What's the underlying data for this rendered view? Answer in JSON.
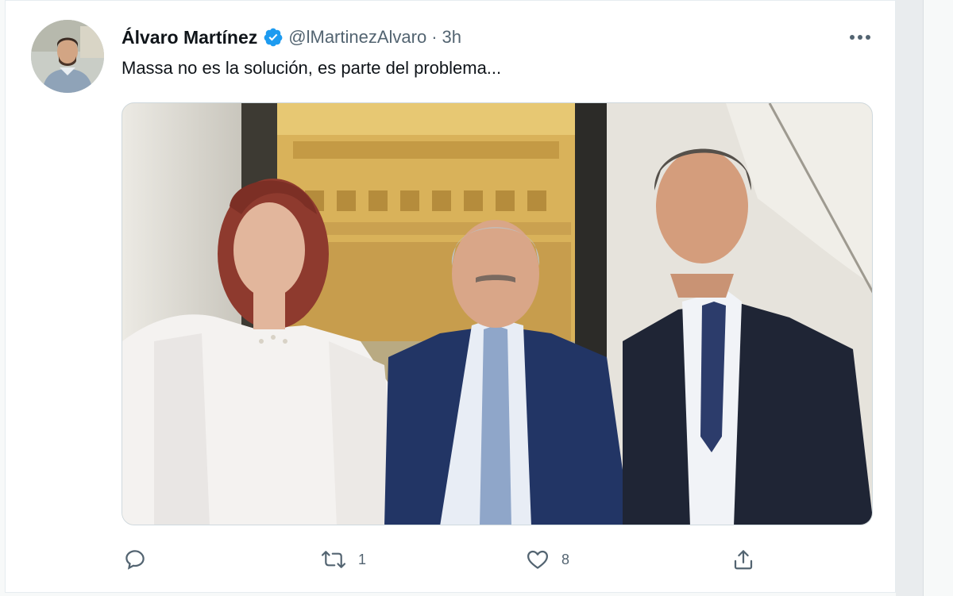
{
  "tweet": {
    "author_name": "Álvaro Martínez",
    "verified": true,
    "handle": "@lMartinezAlvaro",
    "separator": "·",
    "time": "3h",
    "text": "Massa no es la solución, es parte del problema...",
    "more_icon": "more-horizontal-icon"
  },
  "actions": {
    "reply": {
      "icon": "reply-icon",
      "count": ""
    },
    "retweet": {
      "icon": "retweet-icon",
      "count": "1"
    },
    "like": {
      "icon": "heart-icon",
      "count": "8"
    },
    "share": {
      "icon": "share-icon",
      "count": ""
    }
  },
  "colors": {
    "verified_badge": "#1d9bf0",
    "secondary_text": "#536471",
    "primary_text": "#0f1419",
    "border": "#cfd9de"
  }
}
